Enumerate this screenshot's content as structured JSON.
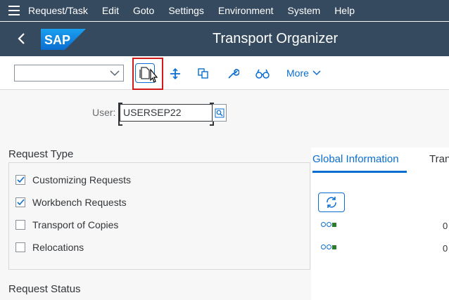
{
  "menu": {
    "items": [
      "Request/Task",
      "Edit",
      "Goto",
      "Settings",
      "Environment",
      "System",
      "Help"
    ]
  },
  "shell": {
    "logo_text": "SAP",
    "title": "Transport Organizer"
  },
  "toolbar": {
    "more_label": "More"
  },
  "user": {
    "label": "User:",
    "value": "USERSEP22"
  },
  "request_type": {
    "title": "Request Type",
    "options": [
      {
        "label": "Customizing Requests",
        "checked": true
      },
      {
        "label": "Workbench Requests",
        "checked": true
      },
      {
        "label": "Transport of Copies",
        "checked": false
      },
      {
        "label": "Relocations",
        "checked": false
      }
    ]
  },
  "request_status": {
    "title": "Request Status"
  },
  "right_panel": {
    "tab_active": "Global Information",
    "tab_other": "Tran",
    "rows": [
      {
        "value": "0"
      },
      {
        "value": "0"
      }
    ]
  },
  "colors": {
    "shell": "#354a5f",
    "accent": "#0a6ed1",
    "highlight": "#cf1b1b"
  }
}
